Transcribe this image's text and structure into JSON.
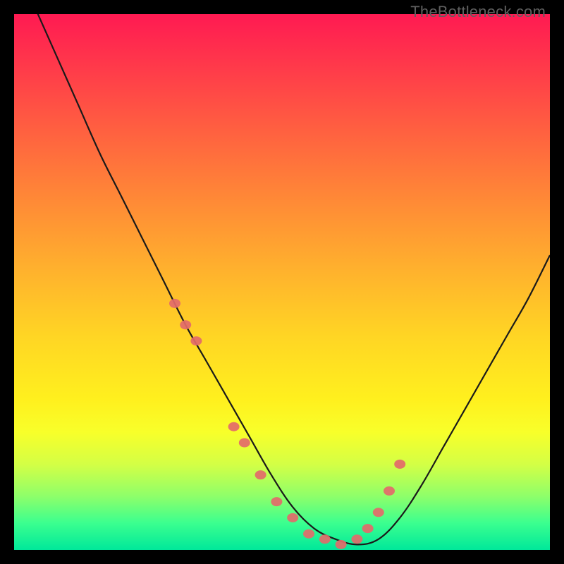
{
  "watermark": "TheBottleneck.com",
  "colors": {
    "background": "#000000",
    "curve_stroke": "#1a1a1a",
    "marker_fill": "#e36a6a",
    "watermark_text": "#5f5f5f"
  },
  "chart_data": {
    "type": "line",
    "title": "",
    "xlabel": "",
    "ylabel": "",
    "xlim": [
      0,
      100
    ],
    "ylim": [
      0,
      100
    ],
    "series": [
      {
        "name": "bottleneck-curve",
        "x": [
          0,
          4,
          8,
          12,
          16,
          20,
          24,
          28,
          32,
          36,
          40,
          44,
          48,
          52,
          56,
          60,
          64,
          68,
          72,
          76,
          80,
          84,
          88,
          92,
          96,
          100
        ],
        "values": [
          110,
          101,
          92,
          83,
          74,
          66,
          58,
          50,
          42,
          35,
          28,
          21,
          14,
          8,
          4,
          2,
          1,
          2,
          6,
          12,
          19,
          26,
          33,
          40,
          47,
          55
        ]
      }
    ],
    "markers": {
      "name": "highlighted-points",
      "x": [
        30,
        32,
        34,
        41,
        43,
        46,
        49,
        52,
        55,
        58,
        61,
        64,
        66,
        68,
        70,
        72
      ],
      "values": [
        46,
        42,
        39,
        23,
        20,
        14,
        9,
        6,
        3,
        2,
        1,
        2,
        4,
        7,
        11,
        16
      ]
    }
  }
}
